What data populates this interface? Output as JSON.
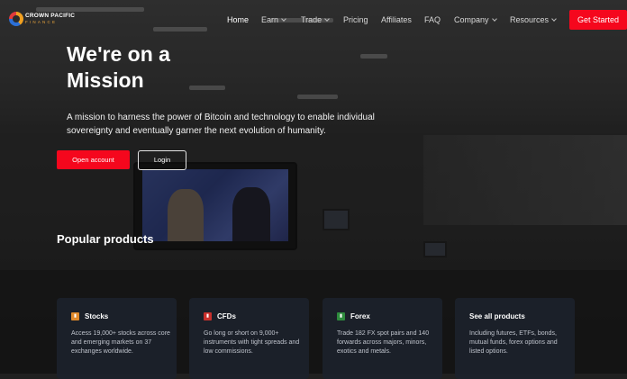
{
  "brand": {
    "name": "CROWN PACIFIC",
    "sub": "FINANCE"
  },
  "nav": {
    "items": [
      {
        "label": "Home",
        "dropdown": false,
        "active": true
      },
      {
        "label": "Earn",
        "dropdown": true
      },
      {
        "label": "Trade",
        "dropdown": true
      },
      {
        "label": "Pricing",
        "dropdown": false
      },
      {
        "label": "Affiliates",
        "dropdown": false
      },
      {
        "label": "FAQ",
        "dropdown": false
      },
      {
        "label": "Company",
        "dropdown": true
      },
      {
        "label": "Resources",
        "dropdown": true
      }
    ],
    "cta_label": "Get Started"
  },
  "hero": {
    "title": "We're on a Mission",
    "description": "A mission to harness the power of Bitcoin and technology to enable individual sovereignty and eventually garner the next evolution of humanity.",
    "primary_button": "Open account",
    "secondary_button": "Login"
  },
  "products": {
    "heading": "Popular products",
    "cards": [
      {
        "title": "Stocks",
        "icon": "stocks-icon",
        "icon_color": "#e0892a",
        "description": "Access 19,000+ stocks across core and emerging markets on 37 exchanges worldwide."
      },
      {
        "title": "CFDs",
        "icon": "cfd-icon",
        "icon_color": "#c9302c",
        "description": "Go long or short on 9,000+ instruments with tight spreads and low commissions."
      },
      {
        "title": "Forex",
        "icon": "forex-icon",
        "icon_color": "#2e8b3d",
        "description": "Trade 182 FX spot pairs and 140 forwards across majors, minors, exotics and metals."
      },
      {
        "title": "See all products",
        "description": "Including futures, ETFs, bonds, mutual funds, forex options and listed options."
      }
    ]
  },
  "colors": {
    "accent": "#f5071d",
    "card_bg": "#1c212b"
  }
}
